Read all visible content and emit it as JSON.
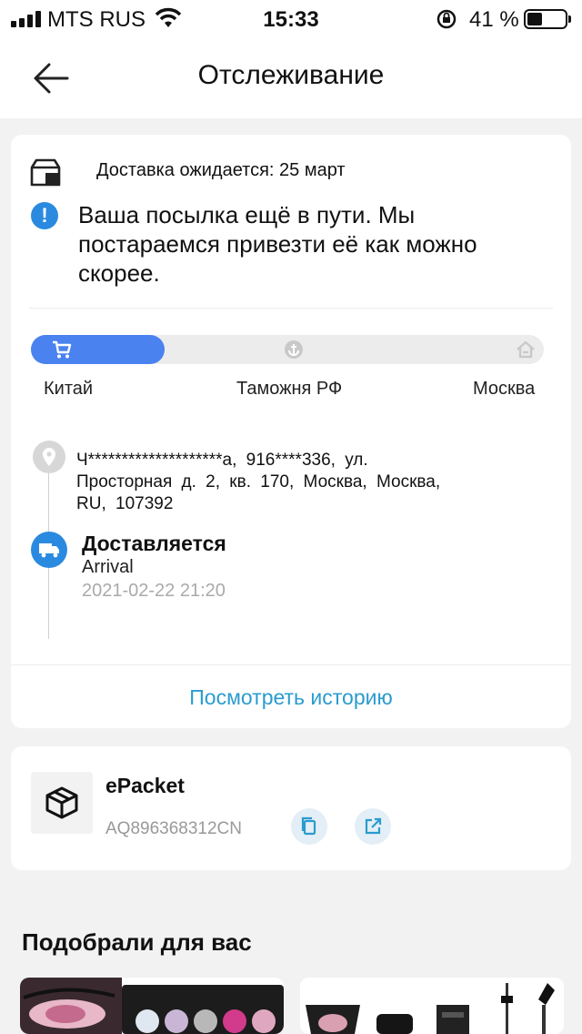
{
  "status_bar": {
    "carrier": "MTS RUS",
    "time": "15:33",
    "battery_percent": "41 %",
    "battery_level": 0.41
  },
  "header": {
    "title": "Отслеживание"
  },
  "tracking": {
    "eta": "Доставка ожидается: 25 март",
    "message": "Ваша посылка ещё в пути. Мы постараемся привезти её как можно скорее.",
    "stages": [
      "Китай",
      "Таможня РФ",
      "Москва"
    ],
    "progress": 0.26,
    "address": "Ч********************а, 916****336, ул. Просторная д. 2, кв. 170, Москва, Москва, RU, 107392",
    "status_title": "Доставляется",
    "status_sub": "Arrival",
    "status_time": "2021-02-22 21:20",
    "history_link": "Посмотреть историю"
  },
  "shipment": {
    "carrier": "ePacket",
    "tracking_number": "AQ896368312CN"
  },
  "recommendations": {
    "title": "Подобрали для вас"
  },
  "colors": {
    "accent": "#4a82f0",
    "link": "#2a9bcf",
    "info": "#2a8ae0"
  }
}
